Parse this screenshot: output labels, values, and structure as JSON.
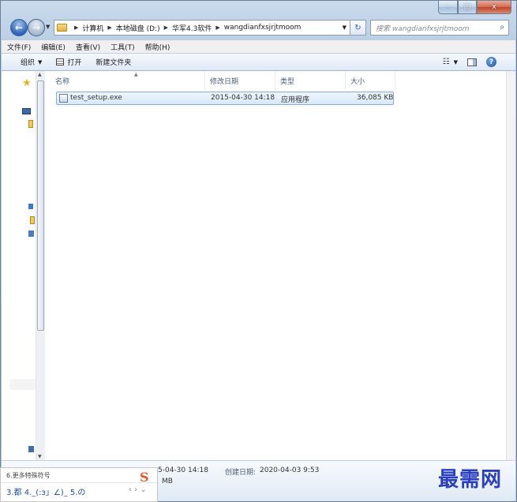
{
  "window": {
    "caption": {
      "minimize": "–",
      "maximize": "□",
      "close": "x"
    }
  },
  "nav": {
    "breadcrumbs": [
      "计算机",
      "本地磁盘 (D:)",
      "华军4.3软件",
      "wangdianfxsjrjtmoom"
    ],
    "search_placeholder": "搜索 wangdianfxsjrjtmoom"
  },
  "menubar": {
    "items": [
      "文件(F)",
      "编辑(E)",
      "查看(V)",
      "工具(T)",
      "帮助(H)"
    ]
  },
  "cmdbar": {
    "organize": "组织",
    "open": "打开",
    "new_folder": "新建文件夹"
  },
  "columns": {
    "name": "名称",
    "date": "修改日期",
    "type": "类型",
    "size": "大小"
  },
  "files": [
    {
      "name": "test_setup.exe",
      "date": "2015-04-30 14:18",
      "type": "应用程序",
      "size": "36,085 KB"
    }
  ],
  "details": {
    "modified_partial": "5-04-30 14:18",
    "size_partial": "MB",
    "created_label": "创建日期:",
    "created_value": "2020-04-03 9:53"
  },
  "ime": {
    "hint": "6.更多特殊符号",
    "candidates": "3.都  4._(:з」∠)_  5.の",
    "logo": "S"
  },
  "watermark": {
    "text": "最需网"
  }
}
